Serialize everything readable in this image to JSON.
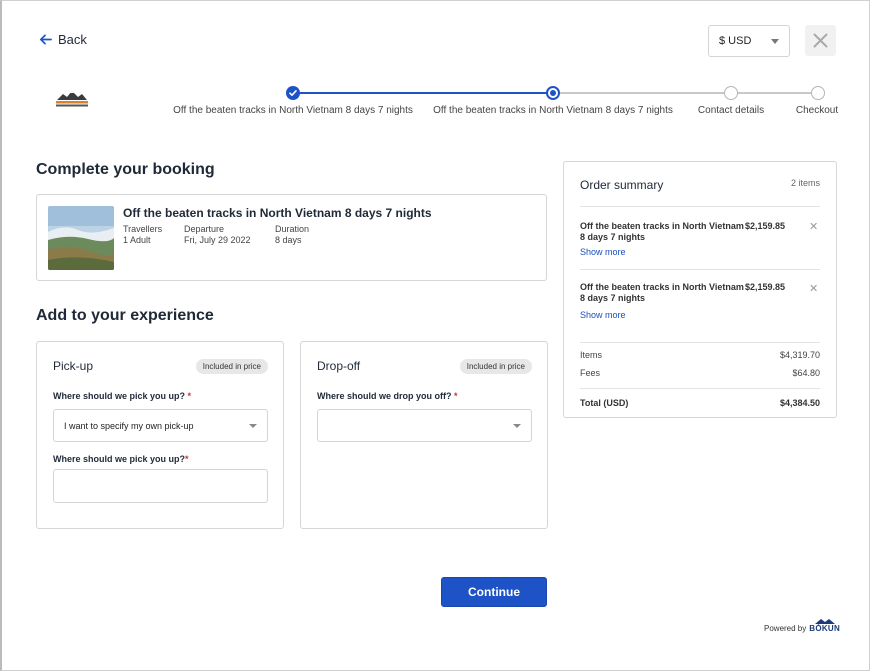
{
  "header": {
    "back_label": "Back",
    "currency": "$ USD"
  },
  "steps": [
    {
      "label": "Off the beaten tracks in North Vietnam 8 days 7 nights",
      "state": "completed"
    },
    {
      "label": "Off the beaten tracks in North Vietnam 8 days 7 nights",
      "state": "current"
    },
    {
      "label": "Contact details",
      "state": "upcoming"
    },
    {
      "label": "Checkout",
      "state": "upcoming"
    }
  ],
  "main": {
    "title": "Complete your booking",
    "booking": {
      "title": "Off the beaten tracks in North Vietnam 8 days 7 nights",
      "travellers_label": "Travellers",
      "travellers_value": "1 Adult",
      "departure_label": "Departure",
      "departure_value": "Fri, July 29 2022",
      "duration_label": "Duration",
      "duration_value": "8 days"
    },
    "experience_title": "Add to your experience",
    "pickup": {
      "title": "Pick-up",
      "badge": "Included in price",
      "select_label": "Where should we pick you up?",
      "select_value": "I want to specify my own pick-up",
      "input_label": "Where should we pick you up?",
      "input_value": ""
    },
    "dropoff": {
      "title": "Drop-off",
      "badge": "Included in price",
      "select_label": "Where should we drop you off?",
      "select_value": ""
    },
    "continue_label": "Continue"
  },
  "summary": {
    "title": "Order summary",
    "count": "2 items",
    "items": [
      {
        "name": "Off the beaten tracks in North Vietnam 8 days 7 nights",
        "price": "$2,159.85",
        "more": "Show more"
      },
      {
        "name": "Off the beaten tracks in North Vietnam 8 days 7 nights",
        "price": "$2,159.85",
        "more": "Show more"
      }
    ],
    "items_label": "Items",
    "items_value": "$4,319.70",
    "fees_label": "Fees",
    "fees_value": "$64.80",
    "total_label": "Total (USD)",
    "total_value": "$4,384.50"
  },
  "footer": {
    "powered_by": "Powered by",
    "brand": "BÓKUN"
  },
  "colors": {
    "accent": "#1e52c7",
    "required": "#d32f2f",
    "link": "#1a4fbe"
  }
}
